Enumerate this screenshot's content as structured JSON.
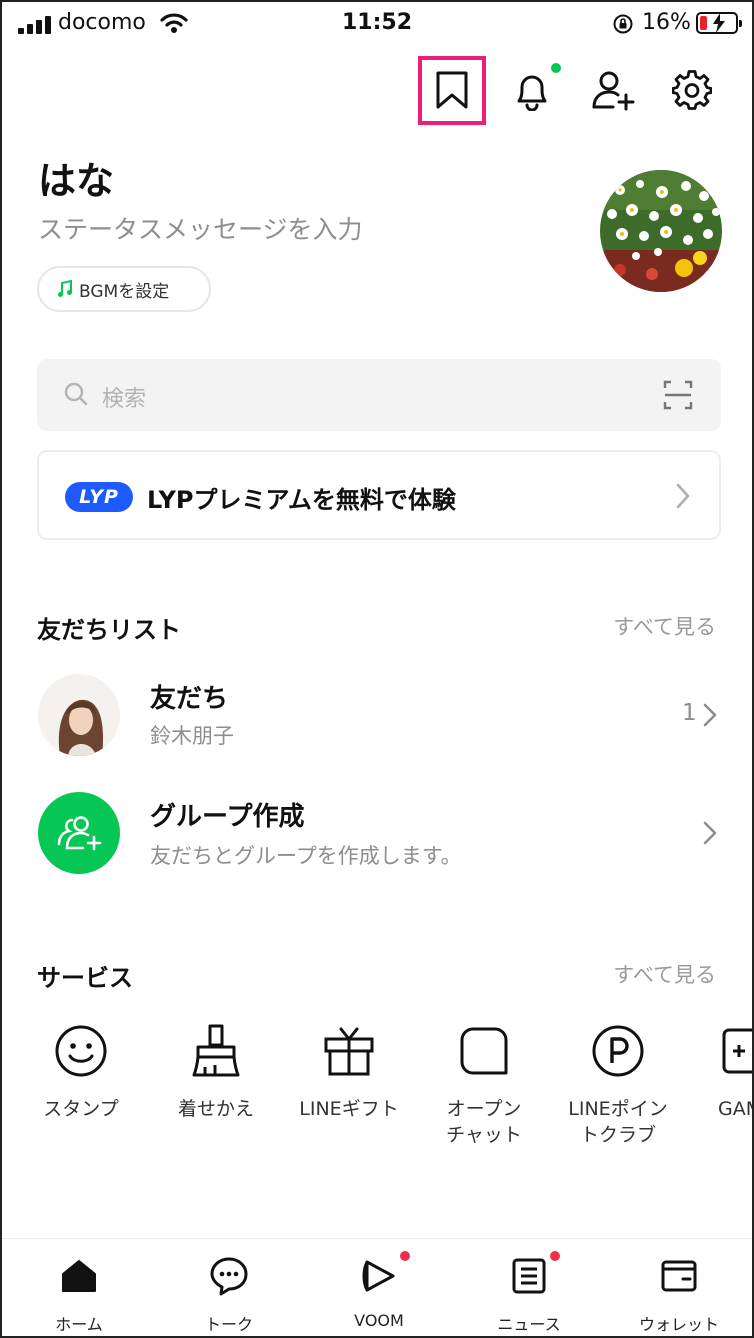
{
  "status_bar": {
    "carrier": "docomo",
    "time": "11:52",
    "battery_percent": "16%",
    "battery_level": 0.16,
    "signal_icon": "signal-bars-icon",
    "wifi_icon": "wifi-icon",
    "rotation_lock_icon": "rotation-lock-icon",
    "battery_icon": "battery-charging-icon"
  },
  "header": {
    "icons": [
      "bookmark-icon",
      "bell-icon",
      "add-friend-icon",
      "gear-icon"
    ],
    "highlight_color": "#ec1f78",
    "notification_dot_color": "#06c755"
  },
  "profile": {
    "name": "はな",
    "status_message": "ステータスメッセージを入力",
    "bgm_label": "BGMを設定",
    "avatar_icon": "flower-photo-avatar"
  },
  "search": {
    "placeholder": "検索",
    "icon": "search-icon",
    "scan_icon": "qr-scan-icon"
  },
  "premium_banner": {
    "logo_text": "LYP",
    "text": "LYPプレミアムを無料で体験",
    "logo_color": "#1e5bff"
  },
  "friends_section": {
    "title": "友だちリスト",
    "see_all": "すべて見る",
    "rows": [
      {
        "title": "友だち",
        "subtitle": "鈴木朋子",
        "count": "1"
      },
      {
        "title": "グループ作成",
        "subtitle": "友だちとグループを作成します。",
        "count": ""
      }
    ],
    "group_icon_color": "#06c755"
  },
  "services_section": {
    "title": "サービス",
    "see_all": "すべて見る",
    "items": [
      {
        "label": "スタンプ",
        "icon": "smiley-icon"
      },
      {
        "label": "着せかえ",
        "icon": "brush-icon"
      },
      {
        "label": "LINEギフト",
        "icon": "gift-icon"
      },
      {
        "label": "オープン\nチャット",
        "icon": "open-chat-icon"
      },
      {
        "label": "LINEポイン\nトクラブ",
        "icon": "points-icon"
      },
      {
        "label": "GAM",
        "icon": "game-icon"
      }
    ]
  },
  "tabbar": {
    "tabs": [
      {
        "label": "ホーム",
        "icon": "home-icon",
        "badge": false
      },
      {
        "label": "トーク",
        "icon": "chat-icon",
        "badge": false
      },
      {
        "label": "VOOM",
        "icon": "voom-icon",
        "badge": true
      },
      {
        "label": "ニュース",
        "icon": "news-icon",
        "badge": true
      },
      {
        "label": "ウォレット",
        "icon": "wallet-icon",
        "badge": false
      }
    ],
    "badge_color": "#f0304a"
  }
}
